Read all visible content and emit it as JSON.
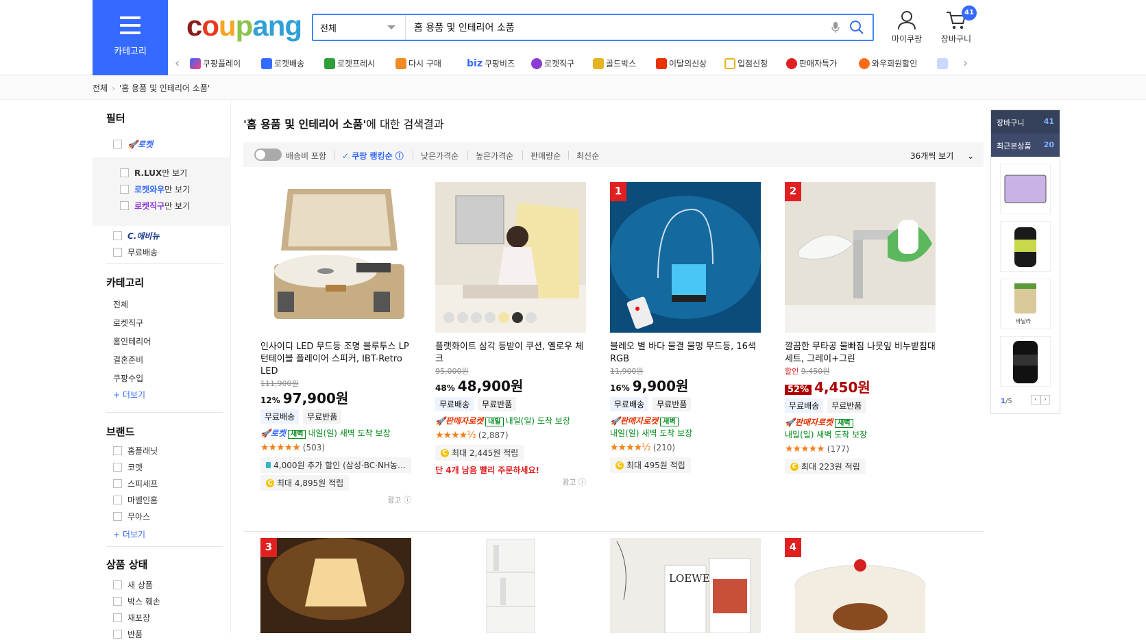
{
  "header": {
    "category_label": "카테고리",
    "logo": "coupang",
    "search": {
      "category": "전체",
      "query": "홈 용품 및 인테리어 소품"
    },
    "my_label": "마이쿠팡",
    "cart_label": "장바구니",
    "cart_count": "41"
  },
  "quick_links": [
    "쿠팡플레이",
    "로켓배송",
    "로켓프레시",
    "다시 구매",
    "쿠팡비즈",
    "로켓직구",
    "골드박스",
    "이달의신상",
    "입점신청",
    "판매자특가",
    "와우회원할인"
  ],
  "breadcrumb": {
    "root": "전체",
    "current": "'홈 용품 및 인테리어 소품'"
  },
  "sidebar": {
    "filter_title": "필터",
    "rocket": "로켓",
    "rlux": "R.LUX",
    "rlux_suffix": "만 보기",
    "rocketwow": "로켓와우",
    "rocketwow_suffix": "만 보기",
    "rocketdirect": "로켓직구",
    "rocketdirect_suffix": "만 보기",
    "ceverything": "C.에비뉴",
    "freeship": "무료배송",
    "category_title": "카테고리",
    "categories": [
      "전체",
      "로켓직구",
      "홈인테리어",
      "결혼준비",
      "쿠팡수입"
    ],
    "more": "+ 더보기",
    "brand_title": "브랜드",
    "brands": [
      "홈플래닛",
      "코멧",
      "스피세프",
      "마벨인홈",
      "무아스"
    ],
    "brand_more": "+ 더보기",
    "condition_title": "상품 상태",
    "conditions": [
      "새 상품",
      "박스 훼손",
      "재포장",
      "반품"
    ]
  },
  "results": {
    "query": "'홈 용품 및 인테리어 소품'",
    "suffix": "에 대한 검색결과"
  },
  "sort": {
    "shipping_toggle": "배송비 포함",
    "options": [
      "쿠팡 랭킹순",
      "낮은가격순",
      "높은가격순",
      "판매량순",
      "최신순"
    ],
    "active": "쿠팡 랭킹순",
    "per_page": "36개씩 보기"
  },
  "products": [
    {
      "name": "인사이디 LED 무드등 조명 블루투스 LP 턴테이블 플레이어 스피커, IBT-Retro LED",
      "orig": "111,900원",
      "pct": "12%",
      "price": "97,900원",
      "badges": [
        "무료배송",
        "무료반품"
      ],
      "rocket": "로켓",
      "rocket_tag": "새벽",
      "delivery": "내일(일) 새벽 도착 보장",
      "rating": 4.5,
      "reviews": "(503)",
      "promo": "4,000원 추가 할인 (삼성·BC·NH농…",
      "points": "최대 4,895원 적립",
      "ad": "광고"
    },
    {
      "name": "플랫화이트 삼각 등받이 쿠션, 옐로우 체크",
      "orig": "95,000원",
      "pct": "48%",
      "price": "48,900원",
      "badges": [
        "무료배송",
        "무료반품"
      ],
      "rocket": "판매자로켓",
      "rocket_tag": "내일",
      "delivery": "내일(일) 도착 보장",
      "rating": 4.5,
      "reviews": "(2,887)",
      "points": "최대 2,445원 적립",
      "warn": "단 4개 남음 빨리 주문하세요!",
      "ad": "광고"
    },
    {
      "rank": "1",
      "name": "블레오 별 바다 물결 물멍 무드등, 16색 RGB",
      "orig": "11,900원",
      "pct": "16%",
      "price": "9,900원",
      "badges": [
        "무료배송",
        "무료반품"
      ],
      "rocket": "판매자로켓",
      "rocket_tag": "새벽",
      "delivery": "내일(일) 새벽 도착 보장",
      "rating": 4.5,
      "reviews": "(210)",
      "points": "최대 495원 적립"
    },
    {
      "rank": "2",
      "name": "깔끔한 무타공 물빠짐 나뭇잎 비누받침대 세트, 그레이+그린",
      "sale_label": "할인",
      "orig": "9,450원",
      "pct": "52%",
      "price": "4,450원",
      "badges": [
        "무료배송",
        "무료반품"
      ],
      "rocket": "판매자로켓",
      "rocket_tag": "새벽",
      "delivery": "내일(일) 새벽 도착 보장",
      "rating": 5,
      "reviews": "(177)",
      "points": "최대 223원 적립"
    }
  ],
  "second_row_ranks": [
    "3",
    "4"
  ],
  "right_panel": {
    "cart_label": "장바구니",
    "cart_count": "41",
    "recent_label": "최근본상품",
    "recent_count": "20",
    "page": "1",
    "pages": "/5"
  }
}
